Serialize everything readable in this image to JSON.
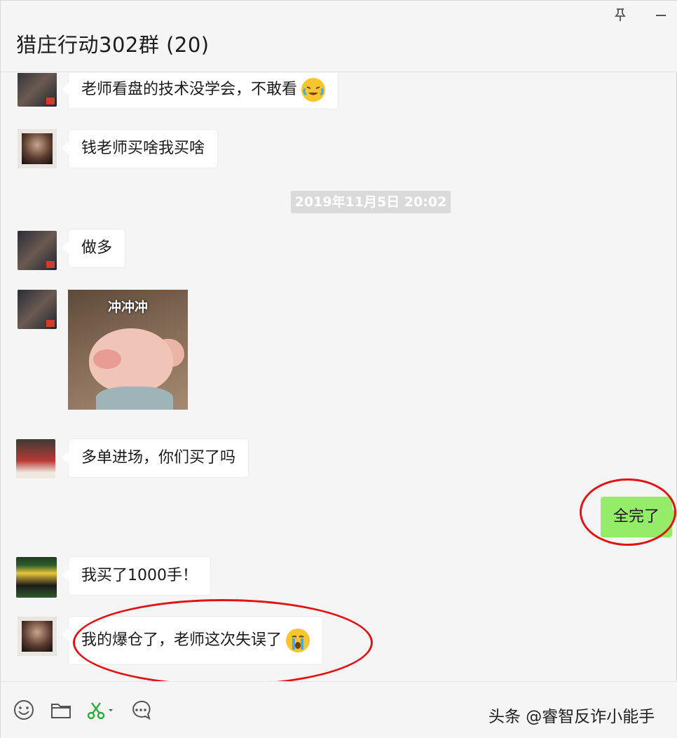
{
  "window": {
    "title": "猎庄行动302群 (20)",
    "pin_icon": "pin-icon",
    "minimize_icon": "minimize-icon"
  },
  "messages": [
    {
      "text": "老师看盘的技术没学会，不敢看",
      "emoji": "laughing-crying-emoji"
    },
    {
      "text": "钱老师买啥我买啥"
    },
    {
      "timestamp": "2019年11月5日 20:02"
    },
    {
      "text": "做多"
    },
    {
      "sticker_caption": "冲冲冲"
    },
    {
      "text": "多单进场，你们买了吗"
    },
    {
      "text": "全完了",
      "mine": true
    },
    {
      "text": "我买了1000手！"
    },
    {
      "text": "我的爆仓了，老师这次失误了",
      "emoji": "crying-emoji"
    }
  ],
  "toolbar": {
    "icons": [
      "emoji-icon",
      "folder-icon",
      "scissors-icon",
      "chat-history-icon"
    ]
  },
  "watermark": "头条 @睿智反诈小能手",
  "colors": {
    "self_bubble": "#95ec69",
    "other_bubble": "#ffffff",
    "highlight_circle": "#e01414",
    "timestamp_bg": "#dadada"
  }
}
